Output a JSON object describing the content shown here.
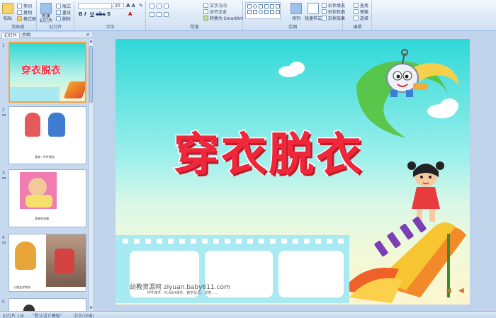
{
  "ribbon": {
    "clipboard": {
      "group_label": "剪贴板",
      "paste": "粘贴",
      "cut": "剪切",
      "copy": "复制",
      "format_painter": "格式刷"
    },
    "slides": {
      "group_label": "幻灯片",
      "new_slide": "新建\n幻灯片",
      "layout": "版式",
      "reset": "重设",
      "delete": "删除"
    },
    "font": {
      "group_label": "字体",
      "font_name": "",
      "font_size": "20"
    },
    "paragraph": {
      "group_label": "段落",
      "text_direction": "文字方向",
      "align_text": "对齐文本",
      "convert_smartart": "转换为 SmartArt"
    },
    "drawing": {
      "group_label": "绘图",
      "arrange": "排列",
      "quick_styles": "快速样式",
      "shape_fill": "形状填充",
      "shape_outline": "形状轮廓",
      "shape_effects": "形状效果"
    },
    "editing": {
      "group_label": "编辑",
      "find": "查找",
      "replace": "替换",
      "select": "选择"
    }
  },
  "pane": {
    "tab_slides": "幻灯片",
    "tab_outline": "大纲",
    "close": "×"
  },
  "thumbnails": [
    {
      "num": "1",
      "caption": "穿衣脱衣"
    },
    {
      "num": "2",
      "caption": "我来一件件脱衣"
    },
    {
      "num": "3",
      "caption": "我来穿衣服"
    },
    {
      "num": "4",
      "caption": "小朋友学穿衣"
    },
    {
      "num": "5",
      "caption": ""
    }
  ],
  "slide": {
    "title": "穿衣脱衣",
    "credit_main": "幼教资源网 ziyuan.baby611.com",
    "credit_sub": "PPT课件、FLASH课件、教学反思、试卷......"
  },
  "status": {
    "slide_count": "幻灯片 1/8",
    "theme": "\"默认设计模板\"",
    "language": "中文(中国)"
  },
  "colors": {
    "title_red": "#f0263b",
    "ribbon_bg": "#dbe8f6",
    "selected_border": "#f3a73b"
  }
}
